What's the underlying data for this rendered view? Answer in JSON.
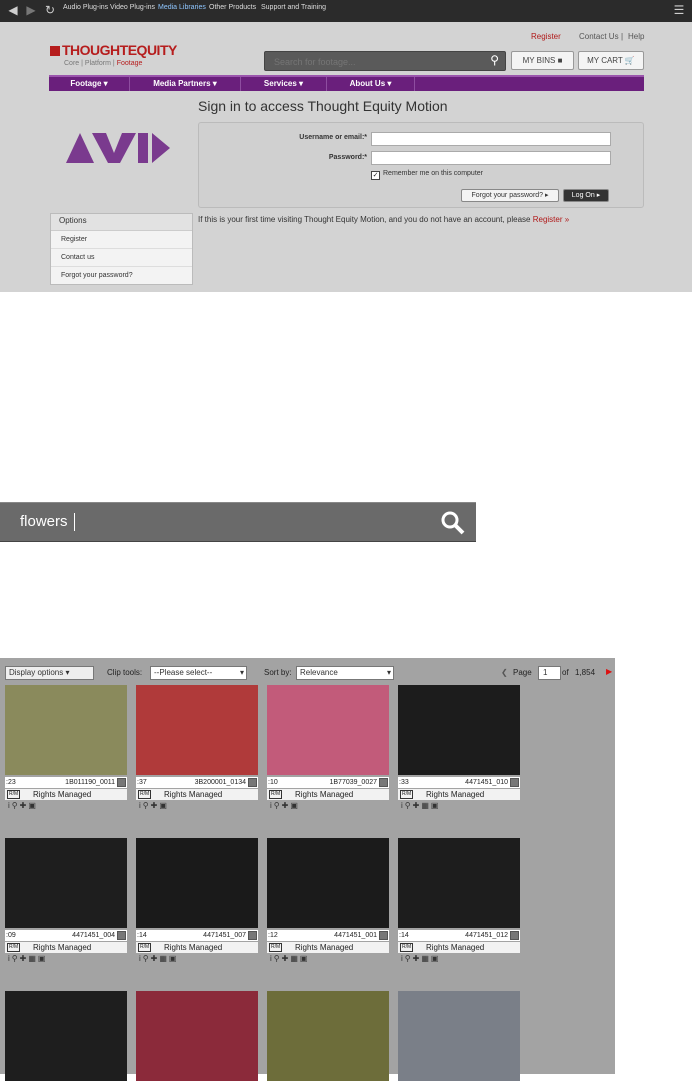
{
  "browser": {
    "nav": [
      "Audio Plug-ins",
      "Video Plug-ins",
      "Media Libraries",
      "Other Products",
      "Support and Training"
    ]
  },
  "site": {
    "toplinks": {
      "register": "Register",
      "contact": "Contact Us",
      "sep": "|",
      "help": "Help"
    },
    "logo": {
      "brand": "THOUGHTEQUITY",
      "sub_core": "Core",
      "sub_platform": "Platform",
      "sub_footage": "Footage"
    },
    "search": {
      "placeholder": "Search for footage..."
    },
    "buttons": {
      "bins": "MY BINS",
      "cart": "MY CART"
    },
    "nav": [
      "Footage",
      "Media Partners",
      "Services",
      "About Us"
    ],
    "signin": {
      "title": "Sign in to access Thought Equity Motion",
      "username_label": "Username or email:*",
      "password_label": "Password:*",
      "remember": "Remember me on this computer",
      "forgot_btn": "Forgot your password?",
      "logon_btn": "Log On"
    },
    "options": {
      "title": "Options",
      "items": [
        "Register",
        "Contact us",
        "Forgot your password?"
      ]
    },
    "firsttime": {
      "text": "If this is your first time visiting Thought Equity Motion, and you do not have an account, please",
      "link": "Register »"
    }
  },
  "bigsearch": {
    "value": "flowers"
  },
  "results": {
    "display_options": "Display options",
    "clip_tools_label": "Clip tools:",
    "clip_tools_value": "--Please select--",
    "sort_label": "Sort by:",
    "sort_value": "Relevance",
    "page_label": "Page",
    "page_value": "1",
    "of_label": "of",
    "total_pages": "1,854",
    "rights_badge": "R/M",
    "clips": [
      {
        "dur": ":23",
        "id": "1B011190_0011",
        "rights": "Rights Managed",
        "color": "#8a8a5c"
      },
      {
        "dur": ":37",
        "id": "3B200001_0134",
        "rights": "Rights Managed",
        "color": "#b03a3a"
      },
      {
        "dur": ":10",
        "id": "1B77039_0027",
        "rights": "Rights Managed",
        "color": "#c25b7a"
      },
      {
        "dur": ":33",
        "id": "4471451_010",
        "rights": "Rights Managed",
        "color": "#1c1c1c"
      },
      {
        "dur": ":09",
        "id": "4471451_004",
        "rights": "Rights Managed",
        "color": "#1e1e1e"
      },
      {
        "dur": ":14",
        "id": "4471451_007",
        "rights": "Rights Managed",
        "color": "#1a1a1a"
      },
      {
        "dur": ":12",
        "id": "4471451_001",
        "rights": "Rights Managed",
        "color": "#1b1b1b"
      },
      {
        "dur": ":14",
        "id": "4471451_012",
        "rights": "Rights Managed",
        "color": "#1d1d1d"
      },
      {
        "dur": "",
        "id": "",
        "rights": "",
        "color": "#1e1e1e"
      },
      {
        "dur": "",
        "id": "",
        "rights": "",
        "color": "#8b2a3a"
      },
      {
        "dur": "",
        "id": "",
        "rights": "",
        "color": "#6d6d3a"
      },
      {
        "dur": "",
        "id": "",
        "rights": "",
        "color": "#7a7f88"
      }
    ]
  }
}
